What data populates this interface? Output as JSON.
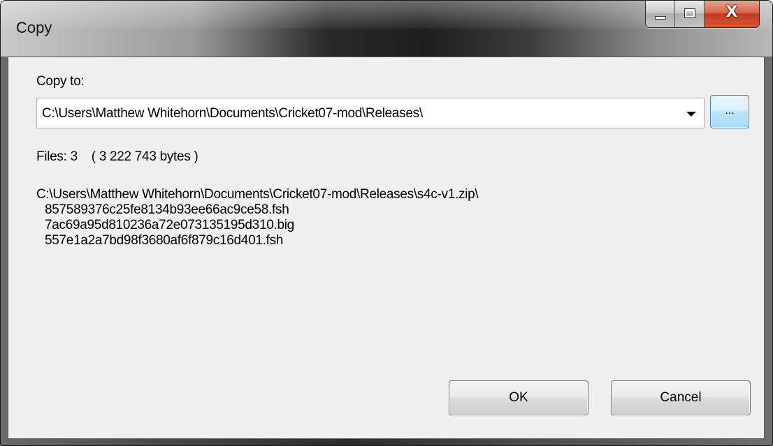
{
  "window": {
    "title": "Copy",
    "controls": {
      "minimize_icon": "minimize-icon",
      "maximize_icon": "maximize-icon",
      "close_icon": "close-icon",
      "close_glyph": "X"
    }
  },
  "copy_to": {
    "label": "Copy to:",
    "path": "C:\\Users\\Matthew Whitehorn\\Documents\\Cricket07-mod\\Releases\\",
    "dropdown_icon": "chevron-down-icon",
    "browse_label": "..."
  },
  "summary": {
    "text": "Files: 3    ( 3 222 743 bytes )"
  },
  "files": {
    "archive": "C:\\Users\\Matthew Whitehorn\\Documents\\Cricket07-mod\\Releases\\s4c-v1.zip\\",
    "entries": [
      "857589376c25fe8134b93ee66ac9ce58.fsh",
      "7ac69a95d810236a72e073135195d310.big",
      "557e1a2a7bd98f3680af6f879c16d401.fsh"
    ]
  },
  "buttons": {
    "ok": "OK",
    "cancel": "Cancel"
  },
  "colors": {
    "client_bg": "#f0f0f0",
    "close_button": "#c23a1e",
    "browse_button": "#bee6fd"
  }
}
